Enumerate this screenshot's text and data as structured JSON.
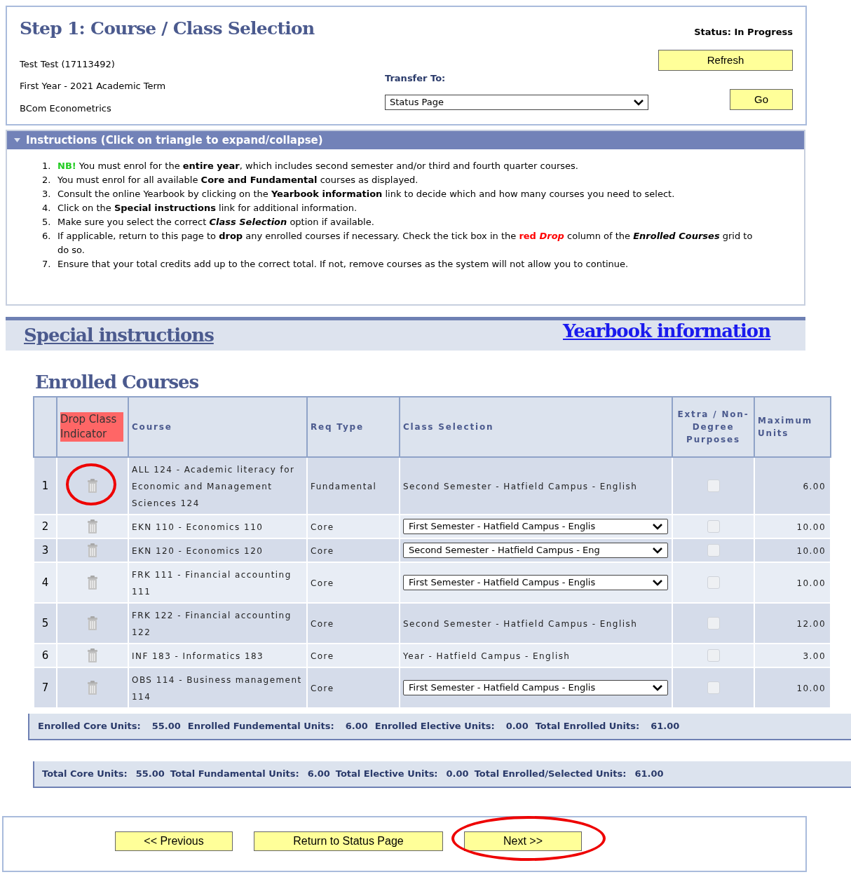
{
  "header": {
    "title": "Step 1: Course / Class Selection",
    "status": "Status: In Progress",
    "student": "Test Test (17113492)",
    "term": "First Year - 2021 Academic Term",
    "programme": "BCom Econometrics",
    "refresh_button": "Refresh",
    "transfer_label": "Transfer To:",
    "transfer_select": "Status Page",
    "go_button": "Go"
  },
  "instructions": {
    "title": "Instructions (Click on triangle to expand/collapse)",
    "expanded": true,
    "items": [
      {
        "number": "1.",
        "parts": [
          {
            "kind": "alert",
            "text": "NB!"
          },
          {
            "kind": "plain",
            "text": " You must enrol for the "
          },
          {
            "kind": "bold",
            "text": "entire year"
          },
          {
            "kind": "plain",
            "text": ", which includes second semester and/or third and fourth quarter courses."
          }
        ]
      },
      {
        "number": "2.",
        "parts": [
          {
            "kind": "plain",
            "text": "You must enrol for all available "
          },
          {
            "kind": "bold",
            "text": "Core and Fundamental"
          },
          {
            "kind": "plain",
            "text": " courses as displayed."
          }
        ]
      },
      {
        "number": "3.",
        "parts": [
          {
            "kind": "plain",
            "text": "Consult the online Yearbook by clicking on the "
          },
          {
            "kind": "bold",
            "text": "Yearbook information"
          },
          {
            "kind": "plain",
            "text": " link to decide which and how many courses you need to select."
          }
        ]
      },
      {
        "number": "4.",
        "parts": [
          {
            "kind": "plain",
            "text": "Click on the "
          },
          {
            "kind": "bold",
            "text": "Special instructions"
          },
          {
            "kind": "plain",
            "text": " link for additional information."
          }
        ]
      },
      {
        "number": "5.",
        "parts": [
          {
            "kind": "plain",
            "text": "Make sure you select the correct "
          },
          {
            "kind": "bold_italic",
            "text": "Class Selection"
          },
          {
            "kind": "plain",
            "text": " option if available."
          }
        ]
      },
      {
        "number": "6.",
        "parts": [
          {
            "kind": "plain",
            "text": "If applicable, return to this page to "
          },
          {
            "kind": "bold",
            "text": "drop"
          },
          {
            "kind": "plain",
            "text": " any enrolled courses if necessary. Check the tick box in the "
          },
          {
            "kind": "red",
            "text": "red "
          },
          {
            "kind": "red_italic",
            "text": "Drop"
          },
          {
            "kind": "plain",
            "text": " column of the "
          },
          {
            "kind": "bold_italic",
            "text": "Enrolled Courses"
          },
          {
            "kind": "plain",
            "text": " grid to do so."
          }
        ]
      },
      {
        "number": "7.",
        "parts": [
          {
            "kind": "plain",
            "text": "Ensure that your total credits add up to the correct total. If not, remove courses as the system will not allow you to continue."
          }
        ]
      }
    ]
  },
  "links": {
    "special": "Special instructions",
    "yearbook": "Yearbook information"
  },
  "enrolled": {
    "title": "Enrolled Courses",
    "columns": [
      "Drop Class Indicator",
      "Course",
      "Req Type",
      "Class Selection",
      "Extra / Non-Degree Purposes",
      "Maximum Units"
    ],
    "rows": [
      {
        "number": "1",
        "circled": true,
        "course": "ALL 124 - Academic literacy for Economic and Management Sciences 124",
        "req_type": "Fundamental",
        "kind": "text",
        "class_selection": "Second Semester - Hatfield Campus - English",
        "extra_checked": false,
        "max_units": "6.00"
      },
      {
        "number": "2",
        "circled": false,
        "course": "EKN 110 - Economics 110",
        "req_type": "Core",
        "kind": "select",
        "class_selection": "First Semester - Hatfield Campus - Englis",
        "extra_checked": false,
        "max_units": "10.00"
      },
      {
        "number": "3",
        "circled": false,
        "course": "EKN 120 - Economics 120",
        "req_type": "Core",
        "kind": "select",
        "class_selection": "Second Semester - Hatfield Campus - Eng",
        "extra_checked": false,
        "max_units": "10.00"
      },
      {
        "number": "4",
        "circled": false,
        "course": "FRK 111 - Financial accounting 111",
        "req_type": "Core",
        "kind": "select",
        "class_selection": "First Semester - Hatfield Campus - Englis",
        "extra_checked": false,
        "max_units": "10.00"
      },
      {
        "number": "5",
        "circled": false,
        "course": "FRK 122 - Financial accounting 122",
        "req_type": "Core",
        "kind": "text",
        "class_selection": "Second Semester - Hatfield Campus - English",
        "extra_checked": false,
        "max_units": "12.00"
      },
      {
        "number": "6",
        "circled": false,
        "course": "INF 183 - Informatics 183",
        "req_type": "Core",
        "kind": "text",
        "class_selection": "Year - Hatfield Campus - English",
        "extra_checked": false,
        "max_units": "3.00"
      },
      {
        "number": "7",
        "circled": false,
        "course": "OBS 114 - Business management 114",
        "req_type": "Core",
        "kind": "select",
        "class_selection": "First Semester - Hatfield Campus - Englis",
        "extra_checked": false,
        "max_units": "10.00"
      }
    ]
  },
  "enrolled_totals": [
    {
      "label": "Enrolled Core Units:",
      "value": "55.00"
    },
    {
      "label": "Enrolled Fundemental Units:",
      "value": "6.00"
    },
    {
      "label": "Enrolled Elective Units:",
      "value": "0.00"
    },
    {
      "label": "Total Enrolled Units:",
      "value": "61.00"
    }
  ],
  "overall_totals": [
    {
      "label": "Total Core Units:",
      "value": "55.00"
    },
    {
      "label": "Total Fundamental Units:",
      "value": "6.00"
    },
    {
      "label": "Total Elective Units:",
      "value": "0.00"
    },
    {
      "label": "Total Enrolled/Selected Units:",
      "value": "61.00"
    }
  ],
  "footer_buttons": [
    {
      "label": "<< Previous",
      "circled": false
    },
    {
      "label": "Return to Status Page",
      "circled": false
    },
    {
      "label": "Next >>",
      "circled": true
    }
  ]
}
